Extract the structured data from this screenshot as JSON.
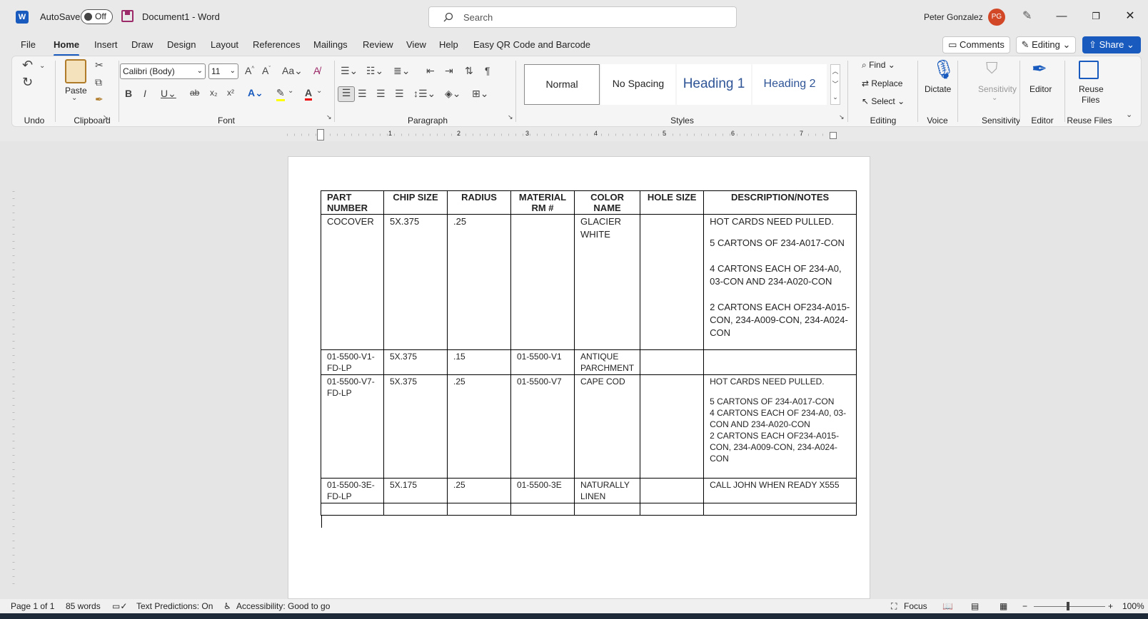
{
  "titlebar": {
    "autosave_label": "AutoSave",
    "autosave_state": "Off",
    "document_title": "Document1  -  Word",
    "search_placeholder": "Search",
    "user_name": "Peter Gonzalez",
    "user_initials": "PG"
  },
  "menu": {
    "tabs": [
      "File",
      "Home",
      "Insert",
      "Draw",
      "Design",
      "Layout",
      "References",
      "Mailings",
      "Review",
      "View",
      "Help",
      "Easy QR Code and Barcode"
    ],
    "active_tab": "Home",
    "comments_label": "Comments",
    "editing_label": "Editing",
    "share_label": "Share"
  },
  "ribbon": {
    "groups": {
      "undo": "Undo",
      "clipboard": "Clipboard",
      "font": "Font",
      "paragraph": "Paragraph",
      "styles": "Styles",
      "editing": "Editing",
      "voice": "Voice",
      "sensitivity": "Sensitivity",
      "editor": "Editor",
      "reuse_files": "Reuse Files"
    },
    "paste_label": "Paste",
    "font_name": "Calibri (Body)",
    "font_size": "11",
    "styles": [
      "Normal",
      "No Spacing",
      "Heading 1",
      "Heading 2"
    ],
    "find_label": "Find",
    "replace_label": "Replace",
    "select_label": "Select",
    "dictate_label": "Dictate",
    "sensitivity_label": "Sensitivity",
    "editor_label": "Editor",
    "reuse_label_1": "Reuse",
    "reuse_label_2": "Files"
  },
  "ruler_numbers": [
    "1",
    "2",
    "3",
    "4",
    "5",
    "6",
    "7"
  ],
  "table": {
    "headers": [
      "PART NUMBER",
      "CHIP SIZE",
      "RADIUS",
      "MATERIAL RM #",
      "COLOR NAME",
      "HOLE SIZE",
      "DESCRIPTION/NOTES"
    ],
    "rows": [
      {
        "part": "COCOVER",
        "chip": "5X.375",
        "radius": ".25",
        "material": "",
        "color": "GLACIER WHITE",
        "hole": "",
        "notes": [
          "HOT CARDS NEED PULLED.",
          "5 CARTONS OF 234-A017-CON",
          "4 CARTONS EACH OF 234-A0, 03-CON AND 234-A020-CON",
          "2 CARTONS EACH OF234-A015-CON,  234-A009-CON, 234-A024-CON"
        ]
      },
      {
        "part": "01-5500-V1-FD-LP",
        "chip": "5X.375",
        "radius": ".15",
        "material": "01-5500-V1",
        "color": "ANTIQUE PARCHMENT",
        "hole": "",
        "notes": [
          ""
        ]
      },
      {
        "part": "01-5500-V7-FD-LP",
        "chip": "5X.375",
        "radius": ".25",
        "material": "01-5500-V7",
        "color": "CAPE COD",
        "hole": "",
        "notes": [
          "HOT CARDS NEED PULLED.",
          "5 CARTONS OF 234-A017-CON",
          "4 CARTONS EACH OF 234-A0, 03-CON AND 234-A020-CON",
          "2 CARTONS EACH OF234-A015-CON,  234-A009-CON, 234-A024-CON"
        ]
      },
      {
        "part": "01-5500-3E-FD-LP",
        "chip": "5X.175",
        "radius": ".25",
        "material": "01-5500-3E",
        "color": "NATURALLY LINEN",
        "hole": "",
        "notes": [
          "CALL JOHN WHEN READY X555"
        ]
      }
    ]
  },
  "status": {
    "page": "Page 1 of 1",
    "words": "85 words",
    "predictions": "Text Predictions: On",
    "accessibility": "Accessibility: Good to go",
    "focus": "Focus",
    "zoom": "100%"
  },
  "colors": {
    "accent": "#185abd",
    "avatar": "#d24726"
  }
}
